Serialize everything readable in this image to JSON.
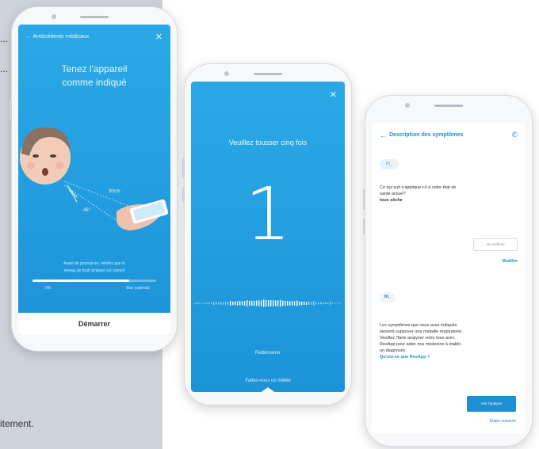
{
  "background_text": {
    "line1": "...",
    "line2": "...",
    "bottom": "itement."
  },
  "phone1": {
    "header_title": "← Antécédents médicaux",
    "close_icon": "close-icon",
    "instruction": "Tenez l'appareil\ncomme indiqué",
    "distance_label": "30cm",
    "angle_label": "45°",
    "caption": "Avant de poursuivre, vérifiez que le\nniveau de bruit ambiant est correct",
    "progress": 0.78,
    "progress_left_label": "0%",
    "progress_right_label": "Bas (optimal)",
    "start_button": "Démarrer",
    "colors": {
      "accent": "#1d93d8",
      "face_bg": "#f2c5b0"
    }
  },
  "phone2": {
    "close_icon": "close-icon",
    "instruction": "Veuillez tousser cinq fois",
    "count": "1",
    "restart_label": "Redémarrer",
    "bottom_hint": "Faites-vous un mêlée",
    "colors": {
      "accent": "#1d93d8"
    }
  },
  "phone3": {
    "back_icon": "arrow-left-icon",
    "title": "Description des symptômes",
    "phone_icon": "phone-icon",
    "avatar1": "m_",
    "question": "Ce qui suit s'applique-t-il à votre état de\nsanté actuel?",
    "answer_text": "toux sèche",
    "answer_chip": "Je confirme",
    "edit_link": "Modifier",
    "avatar2": "m_",
    "message_main": "Les symptômes que vous avez indiqués\nlaissent supposer une maladie respiratoire.\nVeuillez l'faire analyser votre toux avec\nResApp pour aider nos médecins à établir\nun diagnostic.",
    "message_link": "Qu'est-ce que ResApp ?",
    "primary_button": "Voir l'analyse",
    "secondary_link": "Étape suivante",
    "colors": {
      "accent": "#1c8fd6"
    }
  }
}
